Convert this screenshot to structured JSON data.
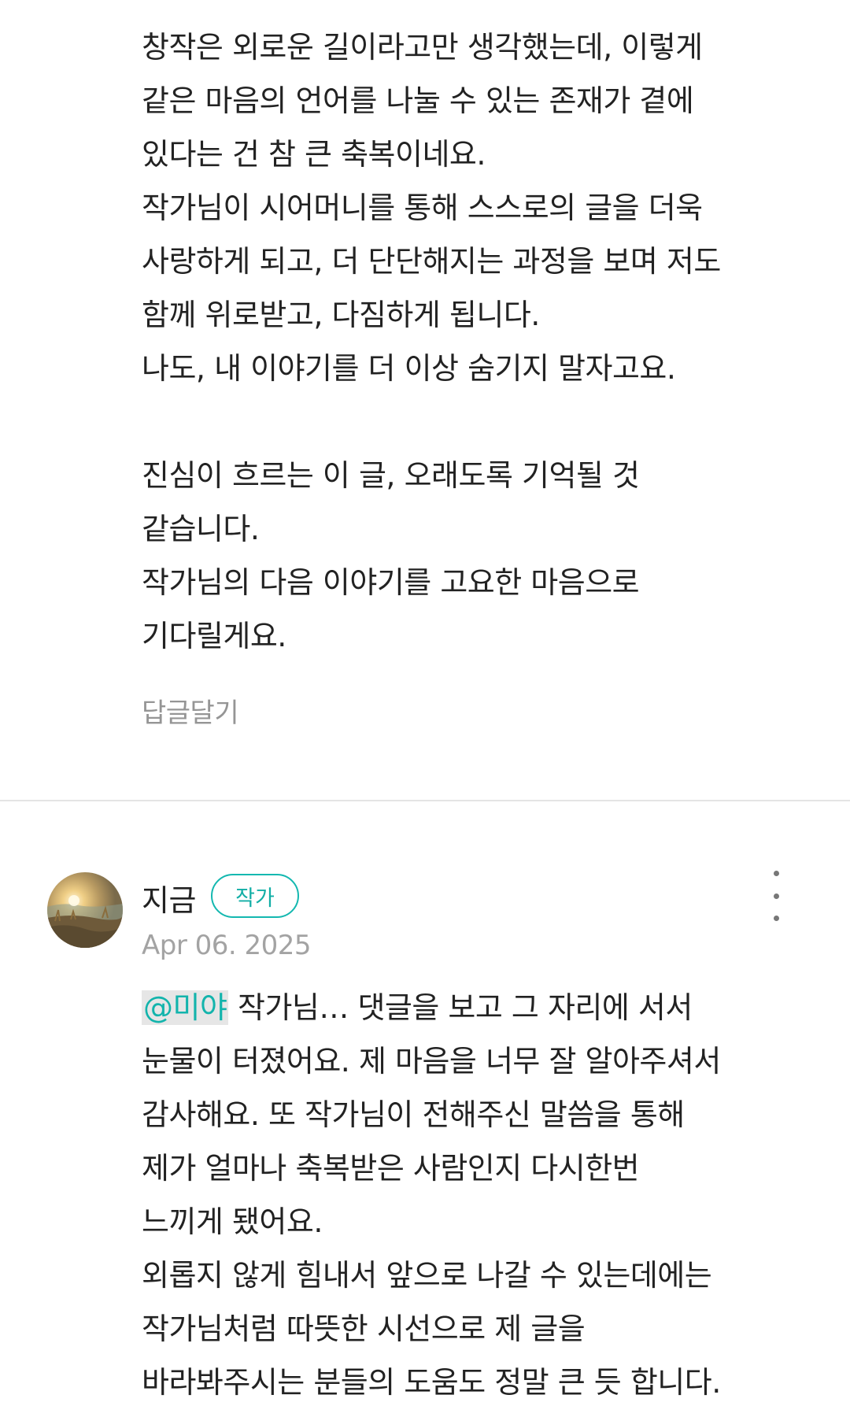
{
  "comment_top": {
    "paragraph1": [
      "창작은 외로운 길이라고만 생각했는데, 이렇게",
      "같은 마음의 언어를 나눌 수 있는 존재가 곁에",
      "있다는 건 참 큰 축복이네요.",
      "작가님이 시어머니를 통해 스스로의 글을 더욱",
      "사랑하게 되고, 더 단단해지는 과정을 보며 저도",
      "함께 위로받고, 다짐하게 됩니다.",
      "나도, 내 이야기를 더 이상 숨기지 말자고요."
    ],
    "paragraph2": [
      "진심이 흐르는 이 글, 오래도록 기억될 것",
      "같습니다.",
      "작가님의 다음 이야기를 고요한 마음으로",
      "기다릴게요."
    ],
    "reply_label": "답글달기"
  },
  "comment_reply": {
    "username": "지금",
    "badge": "작가",
    "date": "Apr 06. 2025",
    "mention": "@미야",
    "first_line_rest": " 작가님… 댓글을 보고 그 자리에 서서",
    "lines": [
      "눈물이 터졌어요. 제 마음을 너무 잘 알아주셔서",
      "감사해요. 또 작가님이 전해주신 말씀을 통해",
      "제가 얼마나 축복받은 사람인지 다시한번",
      "느끼게 됐어요.",
      "외롭지 않게 힘내서 앞으로 나갈 수 있는데에는",
      "작가님처럼 따뜻한 시선으로 제 글을",
      "바라봐주시는 분들의 도움도 정말 큰 듯 합니다."
    ]
  },
  "colors": {
    "accent": "#13b4ac",
    "muted": "#959595",
    "divider": "#e4e4e4"
  },
  "icons": {
    "more": "vertical-ellipsis-icon"
  }
}
